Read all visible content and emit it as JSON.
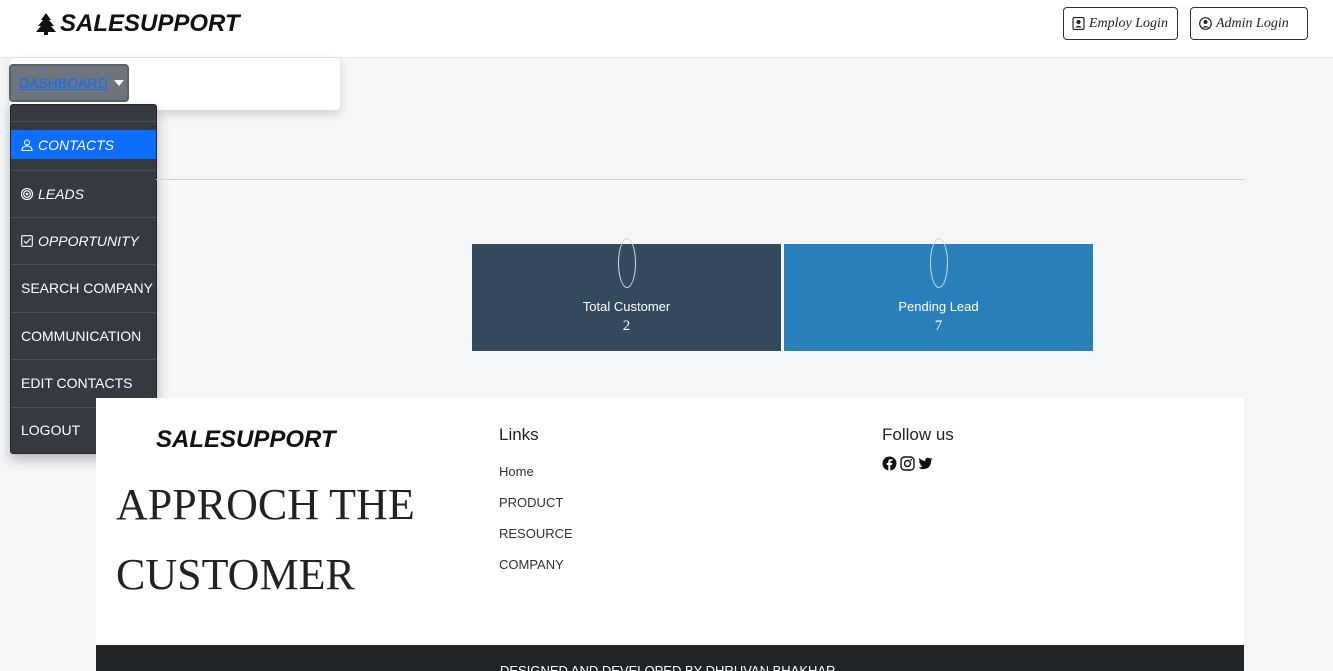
{
  "header": {
    "brand": "SALESUPPORT",
    "employ_login": "Employ Login",
    "admin_login": "Admin Login"
  },
  "dashboard": {
    "toggle_label": "DASHBOARD",
    "menu": [
      {
        "label": "CONTACTS",
        "icon": "user-icon",
        "active": true
      },
      {
        "label": "LEADS",
        "icon": "target-icon"
      },
      {
        "label": "OPPORTUNITY",
        "icon": "checkbox-icon"
      },
      {
        "label": "SEARCH COMPANY"
      },
      {
        "label": "COMMUNICATION"
      },
      {
        "label": "EDIT CONTACTS"
      },
      {
        "label": "LOGOUT"
      }
    ]
  },
  "stats": [
    {
      "label": "Total Customer",
      "value": "2",
      "color": "#34495e"
    },
    {
      "label": "Pending Lead",
      "value": "7",
      "color": "#2980b9"
    }
  ],
  "footer": {
    "brand": "SALESUPPORT",
    "tagline_line1": "APPROCH THE",
    "tagline_line2": "CUSTOMER",
    "links_title": "Links",
    "links": [
      "Home",
      "PRODUCT",
      "RESOURCE",
      "COMPANY"
    ],
    "follow_title": "Follow us",
    "social_icons": [
      "facebook-icon",
      "instagram-icon",
      "twitter-icon"
    ],
    "credit": "DESIGNED AND DEVELOPED BY DHRUVAN BHAKHAR"
  }
}
